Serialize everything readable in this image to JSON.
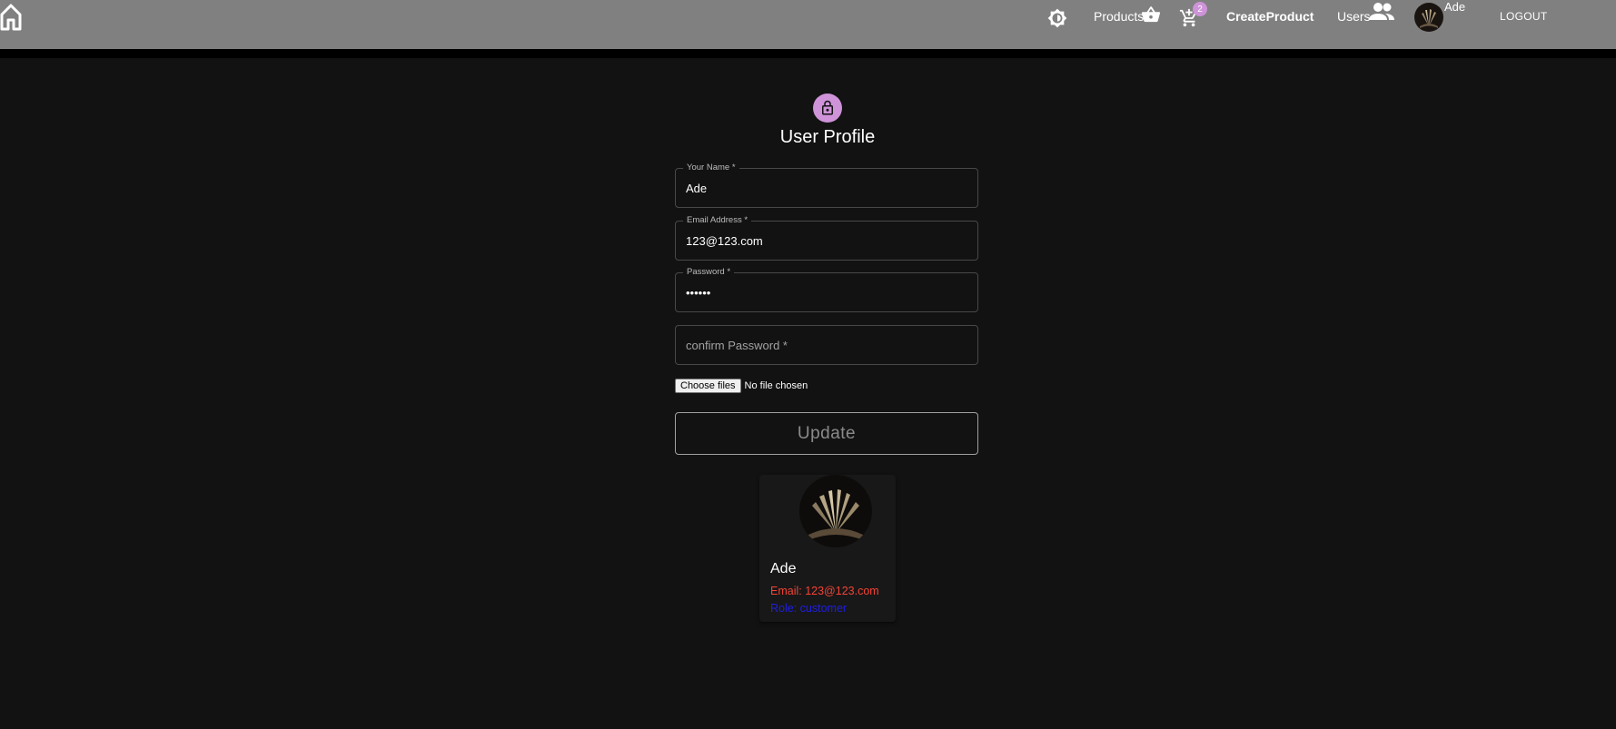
{
  "header": {
    "icons": [
      "home-icon",
      "theme-toggle-icon",
      "basket-icon",
      "cart-icon",
      "users-icon"
    ],
    "products_label": "Products",
    "cart_count": "2",
    "create_product_label": "CreateProduct",
    "users_label": "Users",
    "username": "Ade",
    "logout_label": "LOGOUT"
  },
  "form": {
    "title": "User Profile",
    "name_label": "Your Name *",
    "name_value": "Ade",
    "email_label": "Email Address *",
    "email_value": "123@123.com",
    "password_label": "Password *",
    "password_value": "••••••",
    "confirm_placeholder": "confirm Password *",
    "file_button": "Choose files",
    "file_status": "No file chosen",
    "update_label": "Update"
  },
  "card": {
    "name": "Ade",
    "email": "Email: 123@123.com",
    "role": "Role: customer",
    "colors": {
      "email": "#f44336",
      "role": "#1e1ee6"
    }
  },
  "colors": {
    "accent": "#ce93d8",
    "topbar": "#808080",
    "background": "#121212"
  }
}
